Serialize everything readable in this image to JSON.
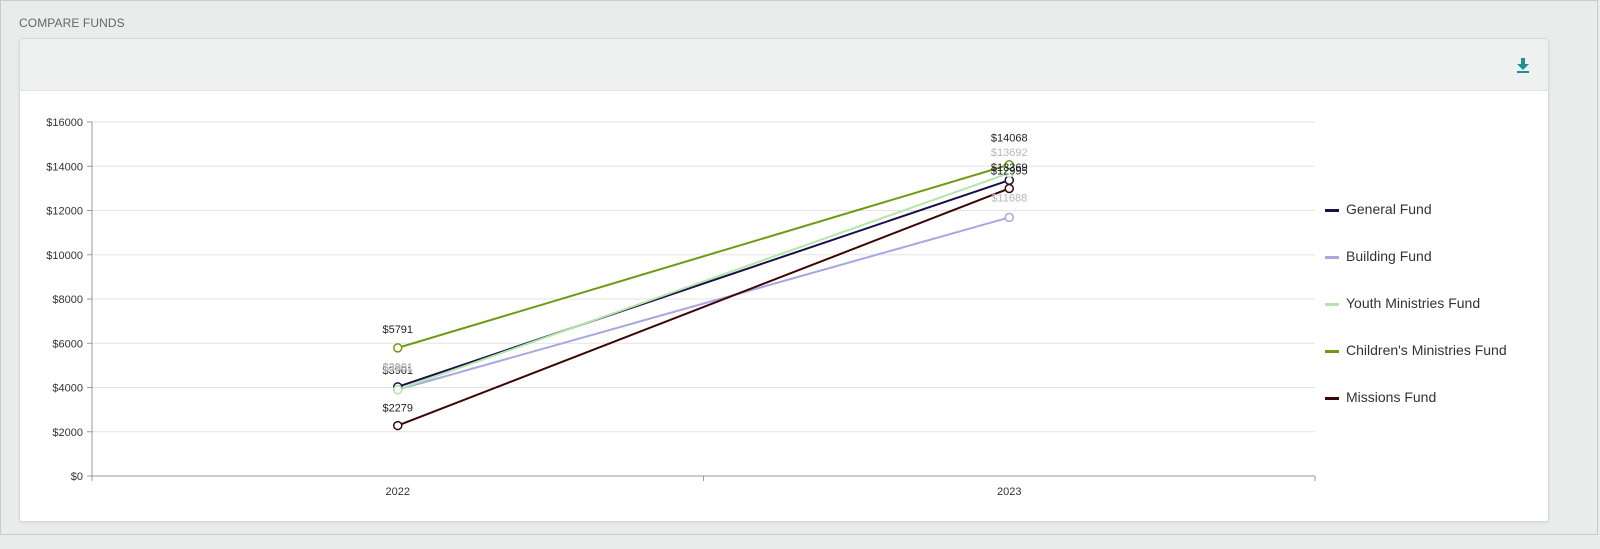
{
  "page": {
    "section_title": "COMPARE FUNDS"
  },
  "toolbar": {
    "download_icon": "download-icon",
    "accent": "#1f8f96"
  },
  "chart_data": {
    "type": "line",
    "categories": [
      "2022",
      "2023"
    ],
    "ylim": [
      0,
      16000
    ],
    "yticks": [
      0,
      2000,
      4000,
      6000,
      8000,
      10000,
      12000,
      14000,
      16000
    ],
    "ytick_labels": [
      "$0",
      "$2000",
      "$4000",
      "$6000",
      "$8000",
      "$10000",
      "$12000",
      "$14000",
      "$16000"
    ],
    "grid": true,
    "legend_position": "right",
    "series": [
      {
        "name": "General Fund",
        "color": "#1a0e4a",
        "values": [
          4030,
          13369
        ],
        "labels": [
          "$3901",
          "$13369"
        ]
      },
      {
        "name": "Building Fund",
        "color": "#a9a7df",
        "values": [
          3901,
          11688
        ],
        "labels": [
          "$3901",
          "$11688"
        ]
      },
      {
        "name": "Youth Ministries Fund",
        "color": "#b3e6a9",
        "values": [
          3901,
          13692
        ],
        "labels": [
          "$3901",
          "$13692"
        ]
      },
      {
        "name": "Children's Ministries Fund",
        "color": "#6f9b13",
        "values": [
          5791,
          14068
        ],
        "labels": [
          "$5791",
          "$14068"
        ]
      },
      {
        "name": "Missions Fund",
        "color": "#3a0606",
        "values": [
          2279,
          12995
        ],
        "labels": [
          "$2279",
          "$12995"
        ]
      }
    ]
  }
}
